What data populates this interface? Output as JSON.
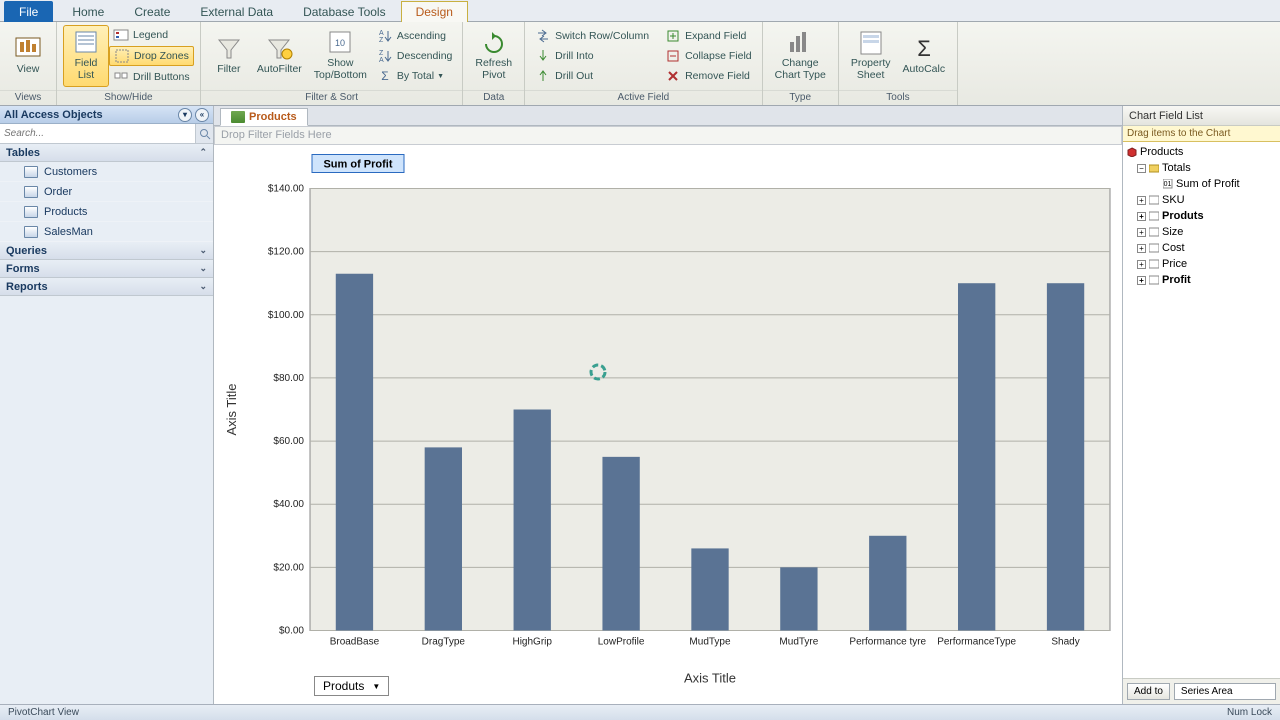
{
  "tabs": {
    "file": "File",
    "home": "Home",
    "create": "Create",
    "external": "External Data",
    "dbtools": "Database Tools",
    "design": "Design"
  },
  "ribbon": {
    "views": {
      "view": "View",
      "group": "Views"
    },
    "showhide": {
      "fieldlist": "Field\nList",
      "legend": "Legend",
      "dropzones": "Drop Zones",
      "drillbuttons": "Drill Buttons",
      "group": "Show/Hide"
    },
    "filtersort": {
      "filter": "Filter",
      "autofilter": "AutoFilter",
      "showtop": "Show\nTop/Bottom",
      "asc": "Ascending",
      "desc": "Descending",
      "bytotal": "By Total",
      "group": "Filter & Sort"
    },
    "data": {
      "refresh": "Refresh\nPivot",
      "group": "Data"
    },
    "activefield": {
      "switch": "Switch Row/Column",
      "drillinto": "Drill Into",
      "drillout": "Drill Out",
      "expand": "Expand Field",
      "collapse": "Collapse Field",
      "remove": "Remove Field",
      "group": "Active Field"
    },
    "type": {
      "change": "Change\nChart Type",
      "group": "Type"
    },
    "tools": {
      "propsheet": "Property\nSheet",
      "autocalc": "AutoCalc",
      "group": "Tools"
    }
  },
  "nav": {
    "header": "All Access Objects",
    "search_placeholder": "Search...",
    "cats": {
      "tables": "Tables",
      "queries": "Queries",
      "forms": "Forms",
      "reports": "Reports"
    },
    "tables": [
      "Customers",
      "Order",
      "Products",
      "SalesMan"
    ]
  },
  "doctab": "Products",
  "dropzone": "Drop Filter Fields Here",
  "legend": "Sum of Profit",
  "category_dd": "Produts",
  "fieldlist": {
    "title": "Chart Field List",
    "subtitle": "Drag items to the Chart",
    "root": "Products",
    "totals": "Totals",
    "sumprofit": "Sum of Profit",
    "fields": [
      "SKU",
      "Produts",
      "Size",
      "Cost",
      "Price",
      "Profit"
    ],
    "addto": "Add to",
    "series": "Series Area"
  },
  "statusbar": {
    "left": "PivotChart View",
    "right": "Num Lock"
  },
  "chart_data": {
    "type": "bar",
    "title": "",
    "xlabel": "Axis Title",
    "ylabel": "Axis Title",
    "ylim": [
      0,
      140
    ],
    "yticks": [
      0,
      20,
      40,
      60,
      80,
      100,
      120,
      140
    ],
    "ytick_labels": [
      "$0.00",
      "$20.00",
      "$40.00",
      "$60.00",
      "$80.00",
      "$100.00",
      "$120.00",
      "$140.00"
    ],
    "categories": [
      "BroadBase",
      "DragType",
      "HighGrip",
      "LowProfile",
      "MudType",
      "MudTyre",
      "Performance tyre",
      "PerformanceType",
      "Shady"
    ],
    "values": [
      113,
      58,
      70,
      55,
      26,
      20,
      30,
      110,
      110
    ],
    "legend": [
      "Sum of Profit"
    ]
  }
}
